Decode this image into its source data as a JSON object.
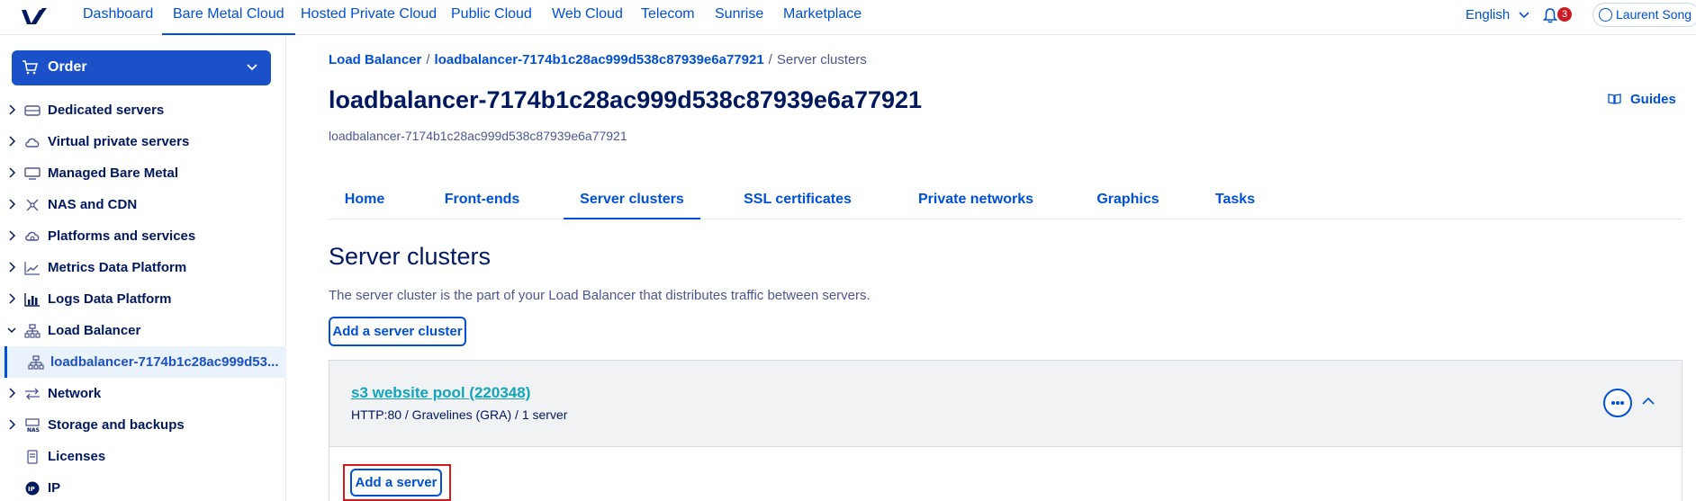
{
  "topnav": {
    "items": [
      "Dashboard",
      "Bare Metal Cloud",
      "Hosted Private Cloud",
      "Public Cloud",
      "Web Cloud",
      "Telecom",
      "Sunrise",
      "Marketplace"
    ],
    "active": "Bare Metal Cloud",
    "language": "English",
    "notification_count": "3",
    "user_name": "Laurent Song",
    "colors": {
      "accent": "#0050d7",
      "badge": "#cc1b25"
    }
  },
  "sidebar": {
    "order_label": "Order",
    "items": [
      {
        "label": "Dedicated servers",
        "icon": "server-icon"
      },
      {
        "label": "Virtual private servers",
        "icon": "cloud-icon"
      },
      {
        "label": "Managed Bare Metal",
        "icon": "monitor-icon"
      },
      {
        "label": "NAS and CDN",
        "icon": "network-arrows-icon"
      },
      {
        "label": "Platforms and services",
        "icon": "cloud-gear-icon"
      },
      {
        "label": "Metrics Data Platform",
        "icon": "line-chart-icon"
      },
      {
        "label": "Logs Data Platform",
        "icon": "bar-chart-icon"
      },
      {
        "label": "Load Balancer",
        "icon": "load-balancer-icon",
        "expanded": true
      },
      {
        "label": "loadbalancer-7174b1c28ac999d53...",
        "icon": "load-balancer-icon",
        "sub": true,
        "selected": true
      },
      {
        "label": "Network",
        "icon": "network-icon"
      },
      {
        "label": "Storage and backups",
        "icon": "storage-icon"
      },
      {
        "label": "Licenses",
        "icon": "document-icon"
      },
      {
        "label": "IP",
        "icon": "ip-icon"
      }
    ]
  },
  "breadcrumb": {
    "items": [
      "Load Balancer",
      "loadbalancer-7174b1c28ac999d538c87939e6a77921"
    ],
    "current": "Server clusters"
  },
  "page": {
    "title": "loadbalancer-7174b1c28ac999d538c87939e6a77921",
    "subtitle": "loadbalancer-7174b1c28ac999d538c87939e6a77921",
    "guides_label": "Guides"
  },
  "tabs": [
    "Home",
    "Front-ends",
    "Server clusters",
    "SSL certificates",
    "Private networks",
    "Graphics",
    "Tasks"
  ],
  "active_tab": "Server clusters",
  "section": {
    "title": "Server clusters",
    "description": "The server cluster is the part of your Load Balancer that distributes traffic between servers.",
    "add_cluster_label": "Add a server cluster"
  },
  "cluster": {
    "name": "s3 website pool (220348)",
    "details": "HTTP:80 / Gravelines (GRA) / 1 server",
    "add_server_label": "Add a server"
  }
}
